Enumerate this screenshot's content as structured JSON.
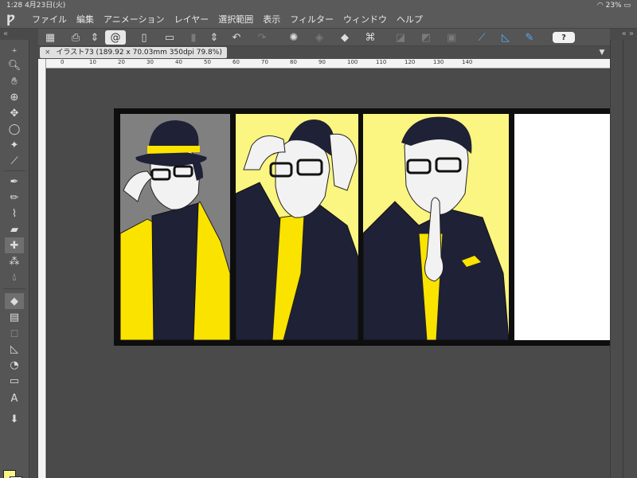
{
  "status": {
    "time_date": "1:28   4月23日(火)",
    "battery": "23%"
  },
  "menu": {
    "items": [
      "ファイル",
      "編集",
      "アニメーション",
      "レイヤー",
      "選択範囲",
      "表示",
      "フィルター",
      "ウィンドウ",
      "ヘルプ"
    ]
  },
  "toolbar": {
    "help_label": "?"
  },
  "document": {
    "tab_title": "イラスト73 (189.92 x 70.03mm 350dpi 79.8%)",
    "close_glyph": "×"
  },
  "ruler": {
    "ticks": [
      "0",
      "10",
      "20",
      "30",
      "40",
      "50",
      "60",
      "70",
      "80",
      "90",
      "100",
      "110",
      "120",
      "130",
      "140"
    ]
  },
  "colors": {
    "foreground": "#f8f48a",
    "background": "#ffffff",
    "accent_yellow": "#fbf581"
  }
}
